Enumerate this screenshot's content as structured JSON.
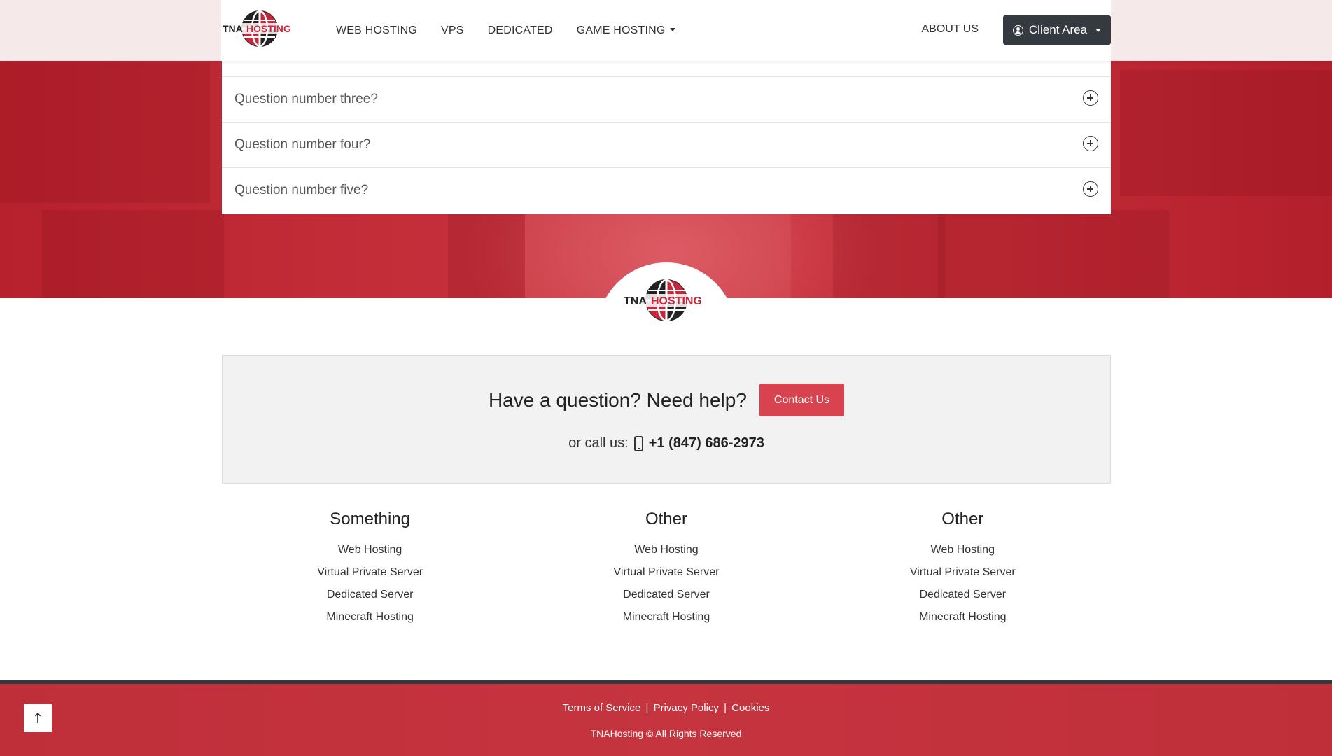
{
  "brand": {
    "logo_text_left": "TNA",
    "logo_text_right": "HOSTING",
    "accent": "#d9434f",
    "dark": "#343a40"
  },
  "nav": {
    "links": [
      "WEB HOSTING",
      "VPS",
      "DEDICATED",
      "GAME HOSTING"
    ],
    "about": "ABOUT US",
    "client_area": "Client Area"
  },
  "faq": {
    "questions": [
      "Question number three?",
      "Question number four?",
      "Question number five?"
    ]
  },
  "help": {
    "title": "Have a question? Need help?",
    "contact_button": "Contact Us",
    "call_label": "or call us:",
    "phone": "+1 (847) 686-2973"
  },
  "columns": [
    {
      "title": "Something",
      "links": [
        "Web Hosting",
        "Virtual Private Server",
        "Dedicated Server",
        "Minecraft Hosting"
      ]
    },
    {
      "title": "Other",
      "links": [
        "Web Hosting",
        "Virtual Private Server",
        "Dedicated Server",
        "Minecraft Hosting"
      ]
    },
    {
      "title": "Other",
      "links": [
        "Web Hosting",
        "Virtual Private Server",
        "Dedicated Server",
        "Minecraft Hosting"
      ]
    }
  ],
  "footer": {
    "links": [
      "Terms of Service",
      "Privacy Policy",
      "Cookies"
    ],
    "separator": "|",
    "copyright": "TNAHosting © All Rights Reserved",
    "back_to_top": "↑"
  }
}
